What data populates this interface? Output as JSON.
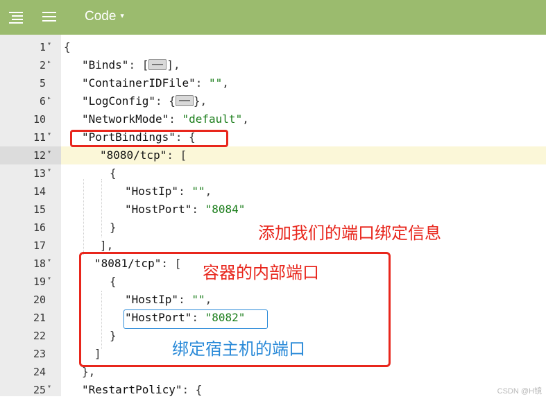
{
  "toolbar": {
    "icons": [
      "align-left-icon",
      "menu-lines-icon"
    ],
    "mode_label": "Code",
    "mode_caret": "▾",
    "bg_color": "#9bbb6e"
  },
  "editor": {
    "active_line": "12",
    "lines": [
      {
        "num": "1",
        "fold": "▾"
      },
      {
        "num": "2",
        "fold": "▸"
      },
      {
        "num": "5",
        "fold": ""
      },
      {
        "num": "6",
        "fold": "▸"
      },
      {
        "num": "10",
        "fold": ""
      },
      {
        "num": "11",
        "fold": "▾"
      },
      {
        "num": "12",
        "fold": "▾"
      },
      {
        "num": "13",
        "fold": "▾"
      },
      {
        "num": "14",
        "fold": ""
      },
      {
        "num": "15",
        "fold": ""
      },
      {
        "num": "16",
        "fold": ""
      },
      {
        "num": "17",
        "fold": ""
      },
      {
        "num": "18",
        "fold": "▾"
      },
      {
        "num": "19",
        "fold": "▾"
      },
      {
        "num": "20",
        "fold": ""
      },
      {
        "num": "21",
        "fold": ""
      },
      {
        "num": "22",
        "fold": ""
      },
      {
        "num": "23",
        "fold": ""
      },
      {
        "num": "24",
        "fold": ""
      },
      {
        "num": "25",
        "fold": "▾"
      }
    ],
    "tokens": {
      "open_brace": "{",
      "binds_key": "\"Binds\"",
      "binds_open": ": [",
      "binds_close": "],",
      "container_key": "\"ContainerIDFile\"",
      "container_val": "\"\"",
      "logconfig_key": "\"LogConfig\"",
      "logconfig_open": ": {",
      "logconfig_close": "},",
      "network_key": "\"NetworkMode\"",
      "network_val": "\"default\"",
      "portbindings_key": "\"PortBindings\"",
      "portbindings_open": ": {",
      "port8080_key": "\"8080/tcp\"",
      "arr_open": ": [",
      "obj_open": "{",
      "hostip_key": "\"HostIp\"",
      "hostip_val": "\"\"",
      "hostport_key": "\"HostPort\"",
      "hostport_8084": "\"8084\"",
      "obj_close": "}",
      "arr_close_comma": "],",
      "port8081_key": "\"8081/tcp\"",
      "hostport_8082": "\"8082\"",
      "arr_close": "]",
      "pb_close": "},",
      "restart_key": "\"RestartPolicy\"",
      "restart_open": ": {"
    }
  },
  "annotations": {
    "add_binding_info": "添加我们的端口绑定信息",
    "container_internal_port": "容器的内部端口",
    "bind_host_port": "绑定宿主机的端口",
    "red_color": "#e8261c",
    "blue_color": "#2a8ad8"
  },
  "watermark": "CSDN @H镜"
}
